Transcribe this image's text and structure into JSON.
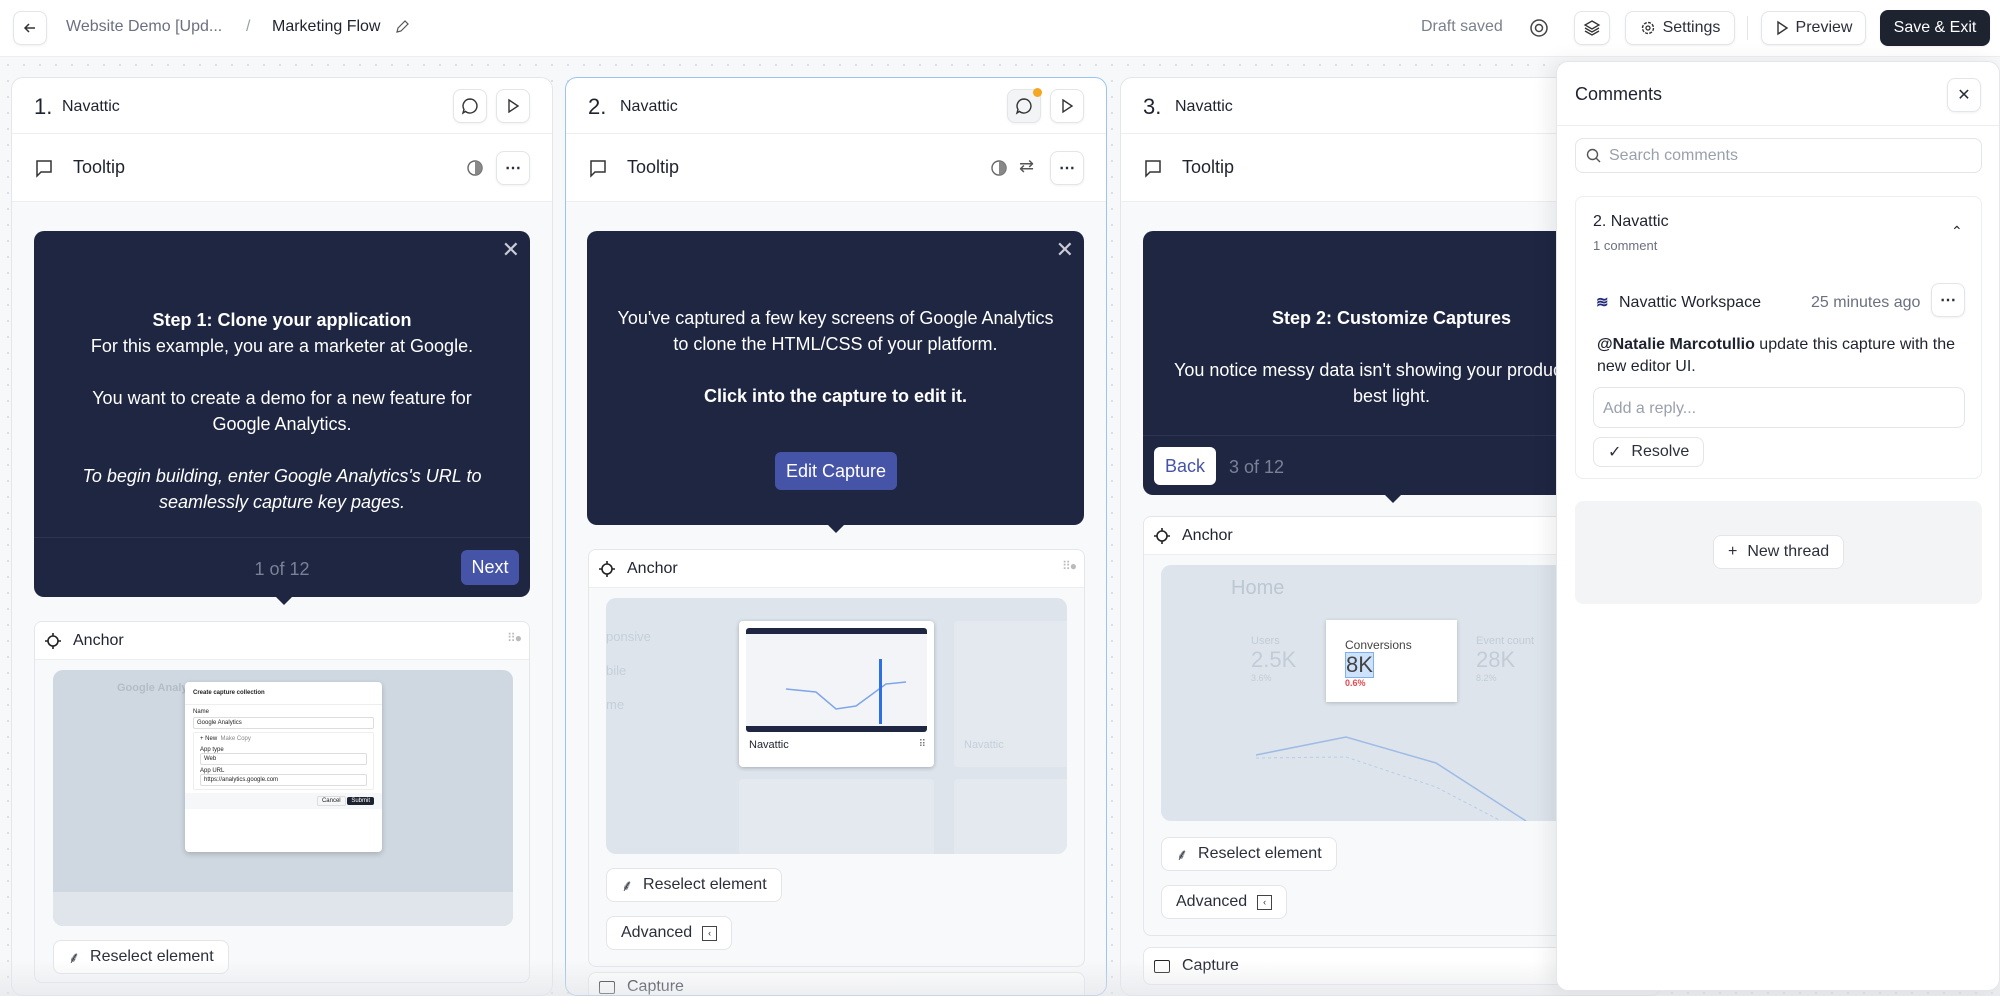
{
  "header": {
    "breadcrumb_parent": "Website Demo [Upd...",
    "separator": "/",
    "flow_title": "Marketing Flow",
    "status": "Draft saved",
    "settings_label": "Settings",
    "preview_label": "Preview",
    "save_exit_label": "Save & Exit"
  },
  "cards": [
    {
      "number": "1.",
      "name": "Navattic",
      "step_type": "Tooltip",
      "tooltip": {
        "title": "Step 1: Clone your application",
        "line1": "For this example, you are a marketer at Google.",
        "line2": "You want to create a demo for a new feature for Google Analytics.",
        "line3": "To begin building, enter Google Analytics's URL to seamlessly capture key pages.",
        "pager": "1 of 12",
        "next_label": "Next"
      },
      "anchor_label": "Anchor",
      "reselect_label": "Reselect element",
      "thumb": {
        "dialog_title": "Create capture collection",
        "name_label": "Name",
        "name_value": "Google Analytics",
        "tab_new": "+ New",
        "tab_copy": "Make Copy",
        "app_type_label": "App type",
        "app_type_value": "Web",
        "app_url_label": "App URL",
        "app_url_value": "https://analytics.google.com",
        "cancel": "Cancel",
        "submit": "Submit",
        "bg_title": "Google Analytics"
      }
    },
    {
      "number": "2.",
      "name": "Navattic",
      "step_type": "Tooltip",
      "has_unread_comment": true,
      "tooltip": {
        "line1": "You've captured a few key screens of Google Analytics to clone the HTML/CSS of your platform.",
        "bold": "Click into the capture to edit it.",
        "button_label": "Edit Capture"
      },
      "anchor_label": "Anchor",
      "thumb": {
        "capture_name": "Navattic",
        "faded_name": "Navattic",
        "side_labels": [
          "ponsive",
          "bile",
          "me"
        ]
      },
      "reselect_label": "Reselect element",
      "advanced_label": "Advanced",
      "capture_label": "Capture"
    },
    {
      "number": "3.",
      "name": "Navattic",
      "step_type": "Tooltip",
      "tooltip": {
        "title": "Step 2: Customize Captures",
        "line1": "You notice messy data isn't showing your product in its best light.",
        "back_label": "Back",
        "pager": "3 of 12"
      },
      "anchor_label": "Anchor",
      "thumb": {
        "page_title": "Home",
        "metrics": [
          {
            "label": "Users",
            "value": "2.5K",
            "change": "3.6%"
          },
          {
            "label": "Conversions",
            "value": "8K",
            "change": "0.6%"
          },
          {
            "label": "Event count",
            "value": "28K",
            "change": "8.2%"
          }
        ]
      },
      "reselect_label": "Reselect element",
      "advanced_label": "Advanced",
      "capture_label": "Capture"
    }
  ],
  "comments": {
    "title": "Comments",
    "search_placeholder": "Search comments",
    "thread": {
      "title": "2. Navattic",
      "count": "1 comment",
      "author": "Navattic Workspace",
      "time": "25 minutes ago",
      "mention": "@Natalie Marcotullio",
      "text": " update this capture with the new editor UI.",
      "reply_placeholder": "Add a reply...",
      "resolve_label": "Resolve"
    },
    "new_thread_label": "New thread"
  },
  "colors": {
    "accent": "#4654a8",
    "tooltip_bg": "#1f2642",
    "primary_button": "#1e2330",
    "notification_dot": "#f5a623",
    "negative": "#e5484d"
  }
}
